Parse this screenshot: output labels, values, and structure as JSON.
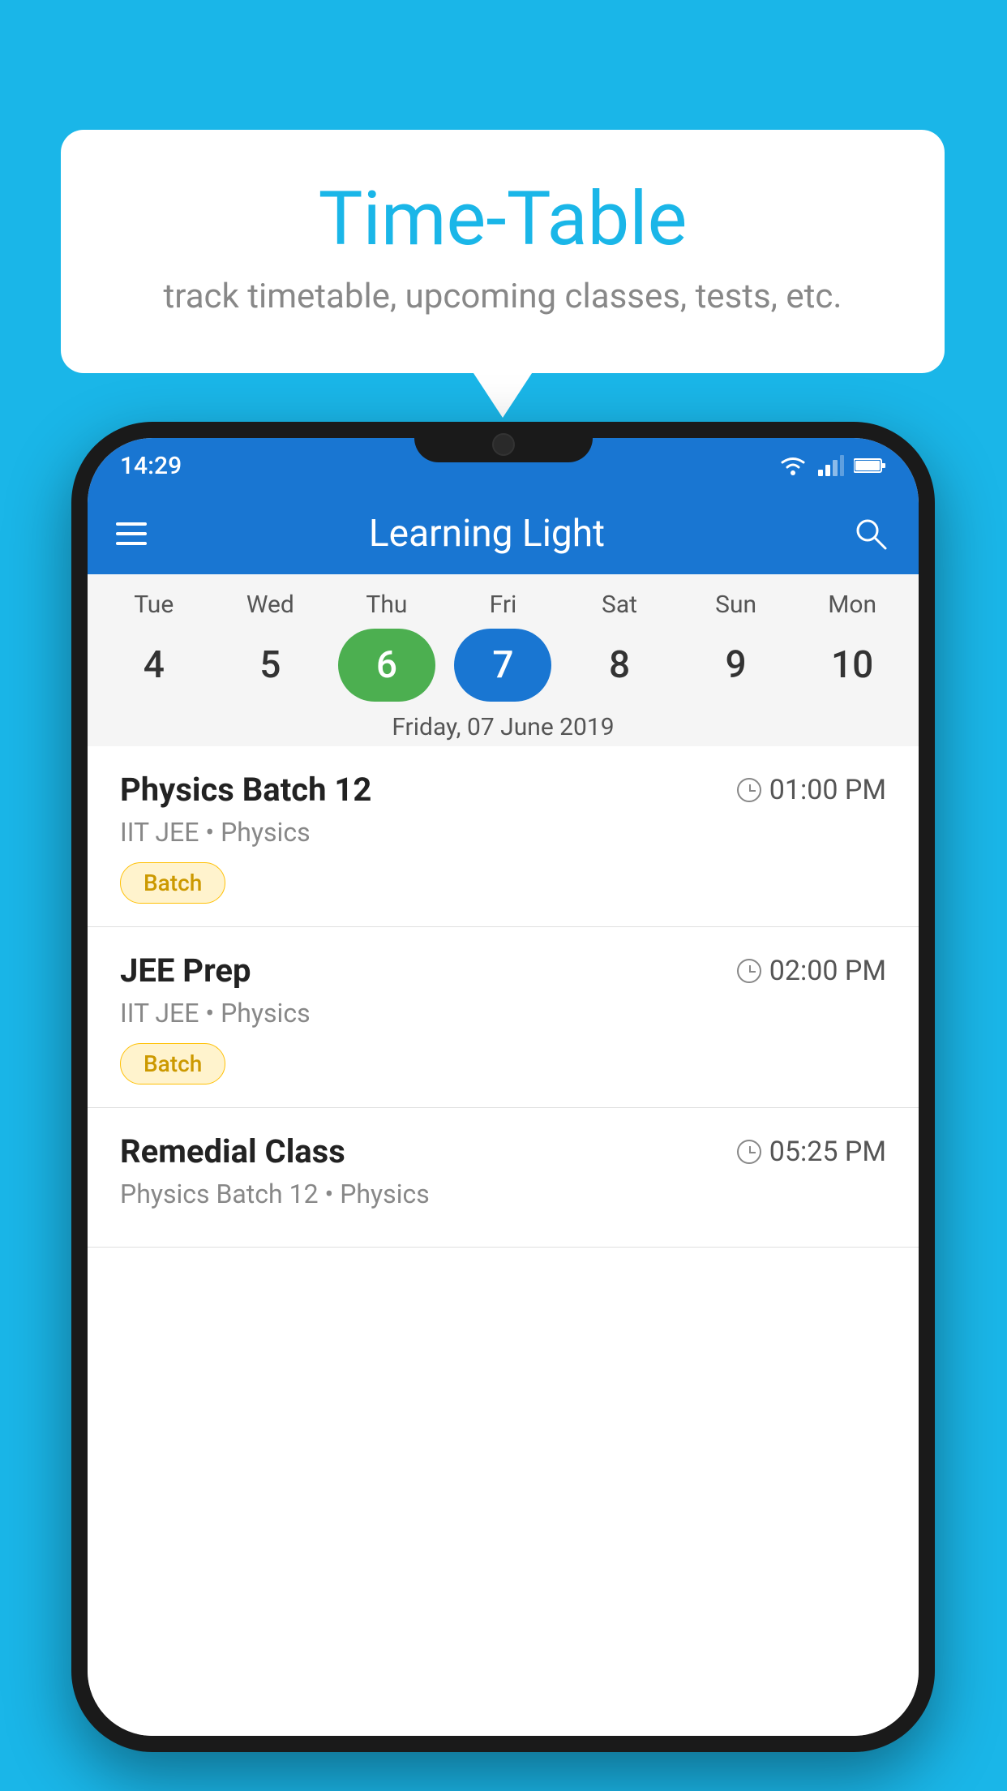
{
  "background_color": "#1ab6e8",
  "bubble": {
    "title": "Time-Table",
    "subtitle": "track timetable, upcoming classes, tests, etc."
  },
  "app": {
    "title": "Learning Light",
    "time": "14:29"
  },
  "calendar": {
    "days": [
      {
        "label": "Tue",
        "number": "4",
        "state": "normal"
      },
      {
        "label": "Wed",
        "number": "5",
        "state": "normal"
      },
      {
        "label": "Thu",
        "number": "6",
        "state": "today"
      },
      {
        "label": "Fri",
        "number": "7",
        "state": "selected"
      },
      {
        "label": "Sat",
        "number": "8",
        "state": "normal"
      },
      {
        "label": "Sun",
        "number": "9",
        "state": "normal"
      },
      {
        "label": "Mon",
        "number": "10",
        "state": "normal"
      }
    ],
    "selected_date_label": "Friday, 07 June 2019"
  },
  "schedule": [
    {
      "title": "Physics Batch 12",
      "time": "01:00 PM",
      "subtitle": "IIT JEE • Physics",
      "badge": "Batch"
    },
    {
      "title": "JEE Prep",
      "time": "02:00 PM",
      "subtitle": "IIT JEE • Physics",
      "badge": "Batch"
    },
    {
      "title": "Remedial Class",
      "time": "05:25 PM",
      "subtitle": "Physics Batch 12 • Physics",
      "badge": null
    }
  ],
  "icons": {
    "hamburger": "☰",
    "search": "🔍"
  }
}
